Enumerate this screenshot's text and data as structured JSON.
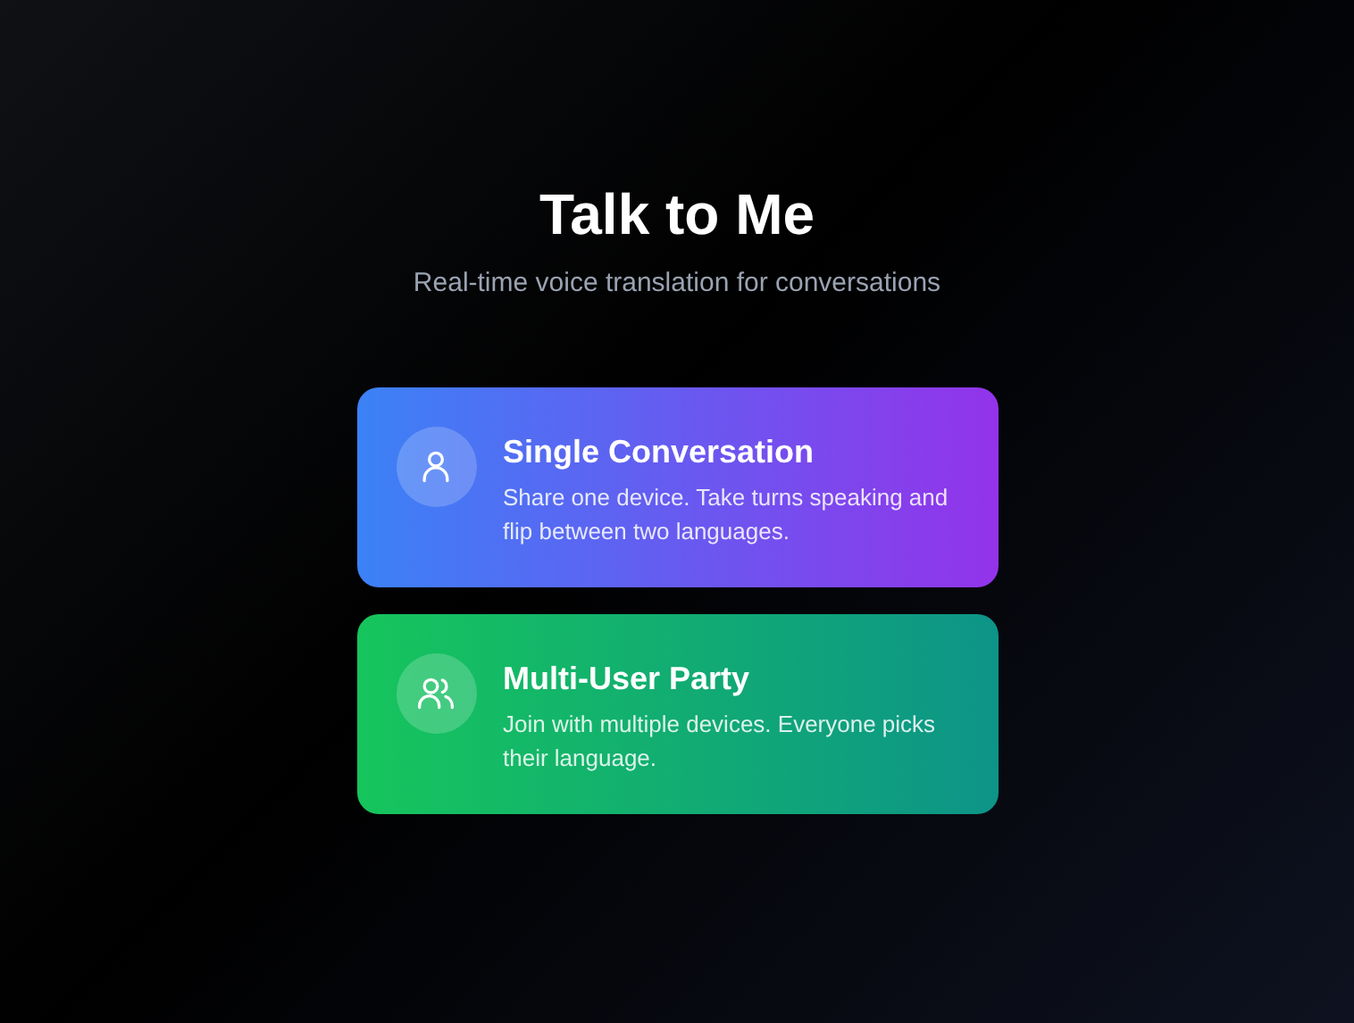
{
  "title": "Talk to Me",
  "subtitle": "Real-time voice translation for conversations",
  "modes": [
    {
      "kind": "single",
      "title": "Single Conversation",
      "description": "Share one device. Take turns speaking and flip between two languages."
    },
    {
      "kind": "multi",
      "title": "Multi-User Party",
      "description": "Join with multiple devices. Everyone picks their language."
    }
  ]
}
